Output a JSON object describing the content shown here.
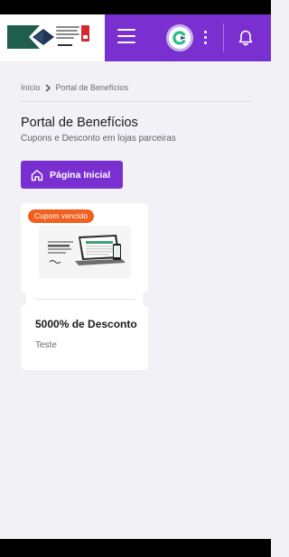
{
  "header": {
    "colors": {
      "brand_purple": "#7a2fd1",
      "logo_green": "#1f5e4d",
      "logo_navy": "#1e3554"
    },
    "icons": {
      "menu": "hamburger-icon",
      "brand": "brand-c-icon",
      "more": "more-vertical-icon",
      "notifications": "bell-icon"
    }
  },
  "breadcrumb": {
    "home": "Início",
    "current": "Portal de Benefícios"
  },
  "page": {
    "title": "Portal de Benefícios",
    "subtitle": "Cupons e Desconto em lojas parceiras"
  },
  "home_button": {
    "label": "Página Inicial",
    "icon": "home-icon"
  },
  "coupons": [
    {
      "status": "Cupom vencido",
      "status_color": "#f2601f",
      "title": "5000% de Desconto",
      "description": "Teste",
      "image": "laptop-phone-promo-image"
    }
  ]
}
